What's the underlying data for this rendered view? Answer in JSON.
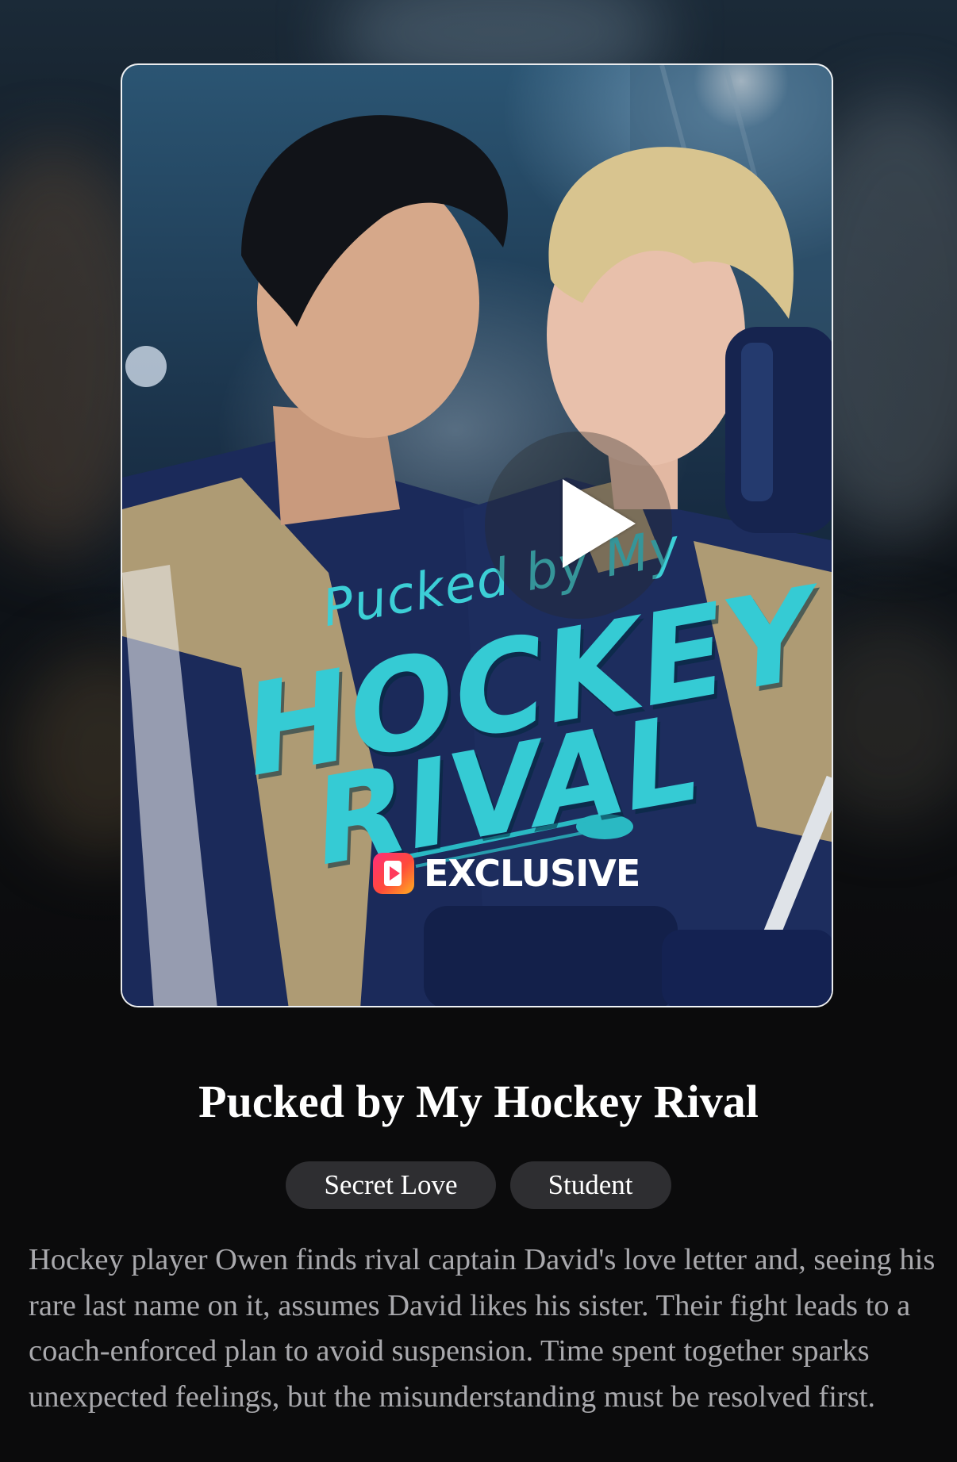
{
  "cover": {
    "art_subtitle": "Pucked by My",
    "art_title_line1": "HOCKEY",
    "art_title_line2": "RIVAL",
    "badge_label": "EXCLUSIVE",
    "badge_icon": "reelshort-play-logo-icon",
    "play_icon": "play-icon"
  },
  "book": {
    "title": "Pucked by My Hockey Rival",
    "tags": [
      "Secret Love",
      "Student"
    ],
    "description": "Hockey player Owen finds rival captain David's love letter and, seeing his rare last name on it, assumes David likes his sister. Their fight leads to a coach-enforced plan to avoid suspension. Time spent together sparks unexpected feelings, but the misunderstanding must be resolved first."
  },
  "colors": {
    "background": "#0b0b0c",
    "tag_background": "#2e2e31",
    "description_text": "#a9a9ad",
    "art_title_teal": "#35cbd4"
  }
}
